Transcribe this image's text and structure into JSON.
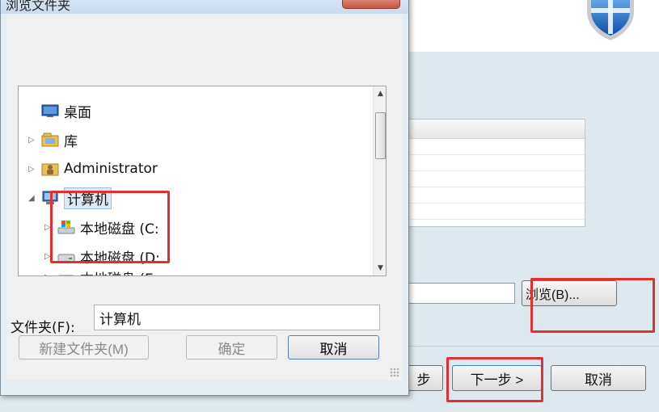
{
  "dialog": {
    "title": "浏览文件夹",
    "tree": [
      {
        "label": "桌面",
        "icon": "desktop-icon",
        "expander": "",
        "indent": 0
      },
      {
        "label": "库",
        "icon": "libraries-icon",
        "expander": "▷",
        "indent": 0
      },
      {
        "label": "Administrator",
        "icon": "user-folder-icon",
        "expander": "▷",
        "indent": 0
      },
      {
        "label": "计算机",
        "icon": "computer-icon",
        "expander": "◢",
        "indent": 0,
        "selected": true
      },
      {
        "label": "本地磁盘 (C:",
        "icon": "system-drive-icon",
        "expander": "▷",
        "indent": 1
      },
      {
        "label": "本地磁盘 (D:",
        "icon": "drive-icon",
        "expander": "▷",
        "indent": 1
      },
      {
        "label": "本地磁盘 (E:",
        "icon": "drive-icon",
        "expander": "▷",
        "indent": 1
      }
    ],
    "folder_label": "文件夹(F):",
    "folder_value": "计算机",
    "new_folder_label": "新建文件夹(M)",
    "ok_label": "确定",
    "cancel_label": "取消"
  },
  "wizard": {
    "browse_label": "浏览(B)...",
    "prev_label": "步",
    "next_label": "下一步 >",
    "cancel_label": "取消"
  },
  "colors": {
    "highlight": "#e03030",
    "dialog_frame": "#e4ecf4",
    "wizard_body": "#dde9ee"
  }
}
